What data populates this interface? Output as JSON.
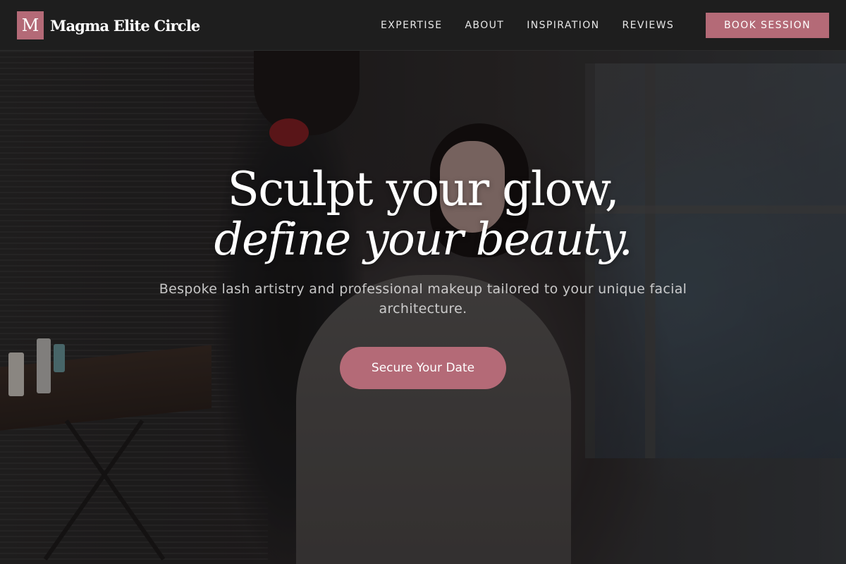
{
  "header": {
    "logo_letter": "M",
    "brand_name": "Magma Elite Circle",
    "nav": [
      {
        "label": "EXPERTISE"
      },
      {
        "label": "ABOUT"
      },
      {
        "label": "INSPIRATION"
      },
      {
        "label": "REVIEWS"
      }
    ],
    "book_label": "BOOK SESSION"
  },
  "hero": {
    "headline_line1": "Sculpt your glow,",
    "headline_line2": "define your beauty.",
    "subtitle": "Bespoke lash artistry and professional makeup tailored to your unique facial architecture.",
    "cta_label": "Secure Your Date",
    "background_image": "makeup-artist-applying-makeup-photo"
  },
  "colors": {
    "accent": "#b46a77",
    "header_bg": "#1e1e1e",
    "text_light": "#ffffff"
  }
}
